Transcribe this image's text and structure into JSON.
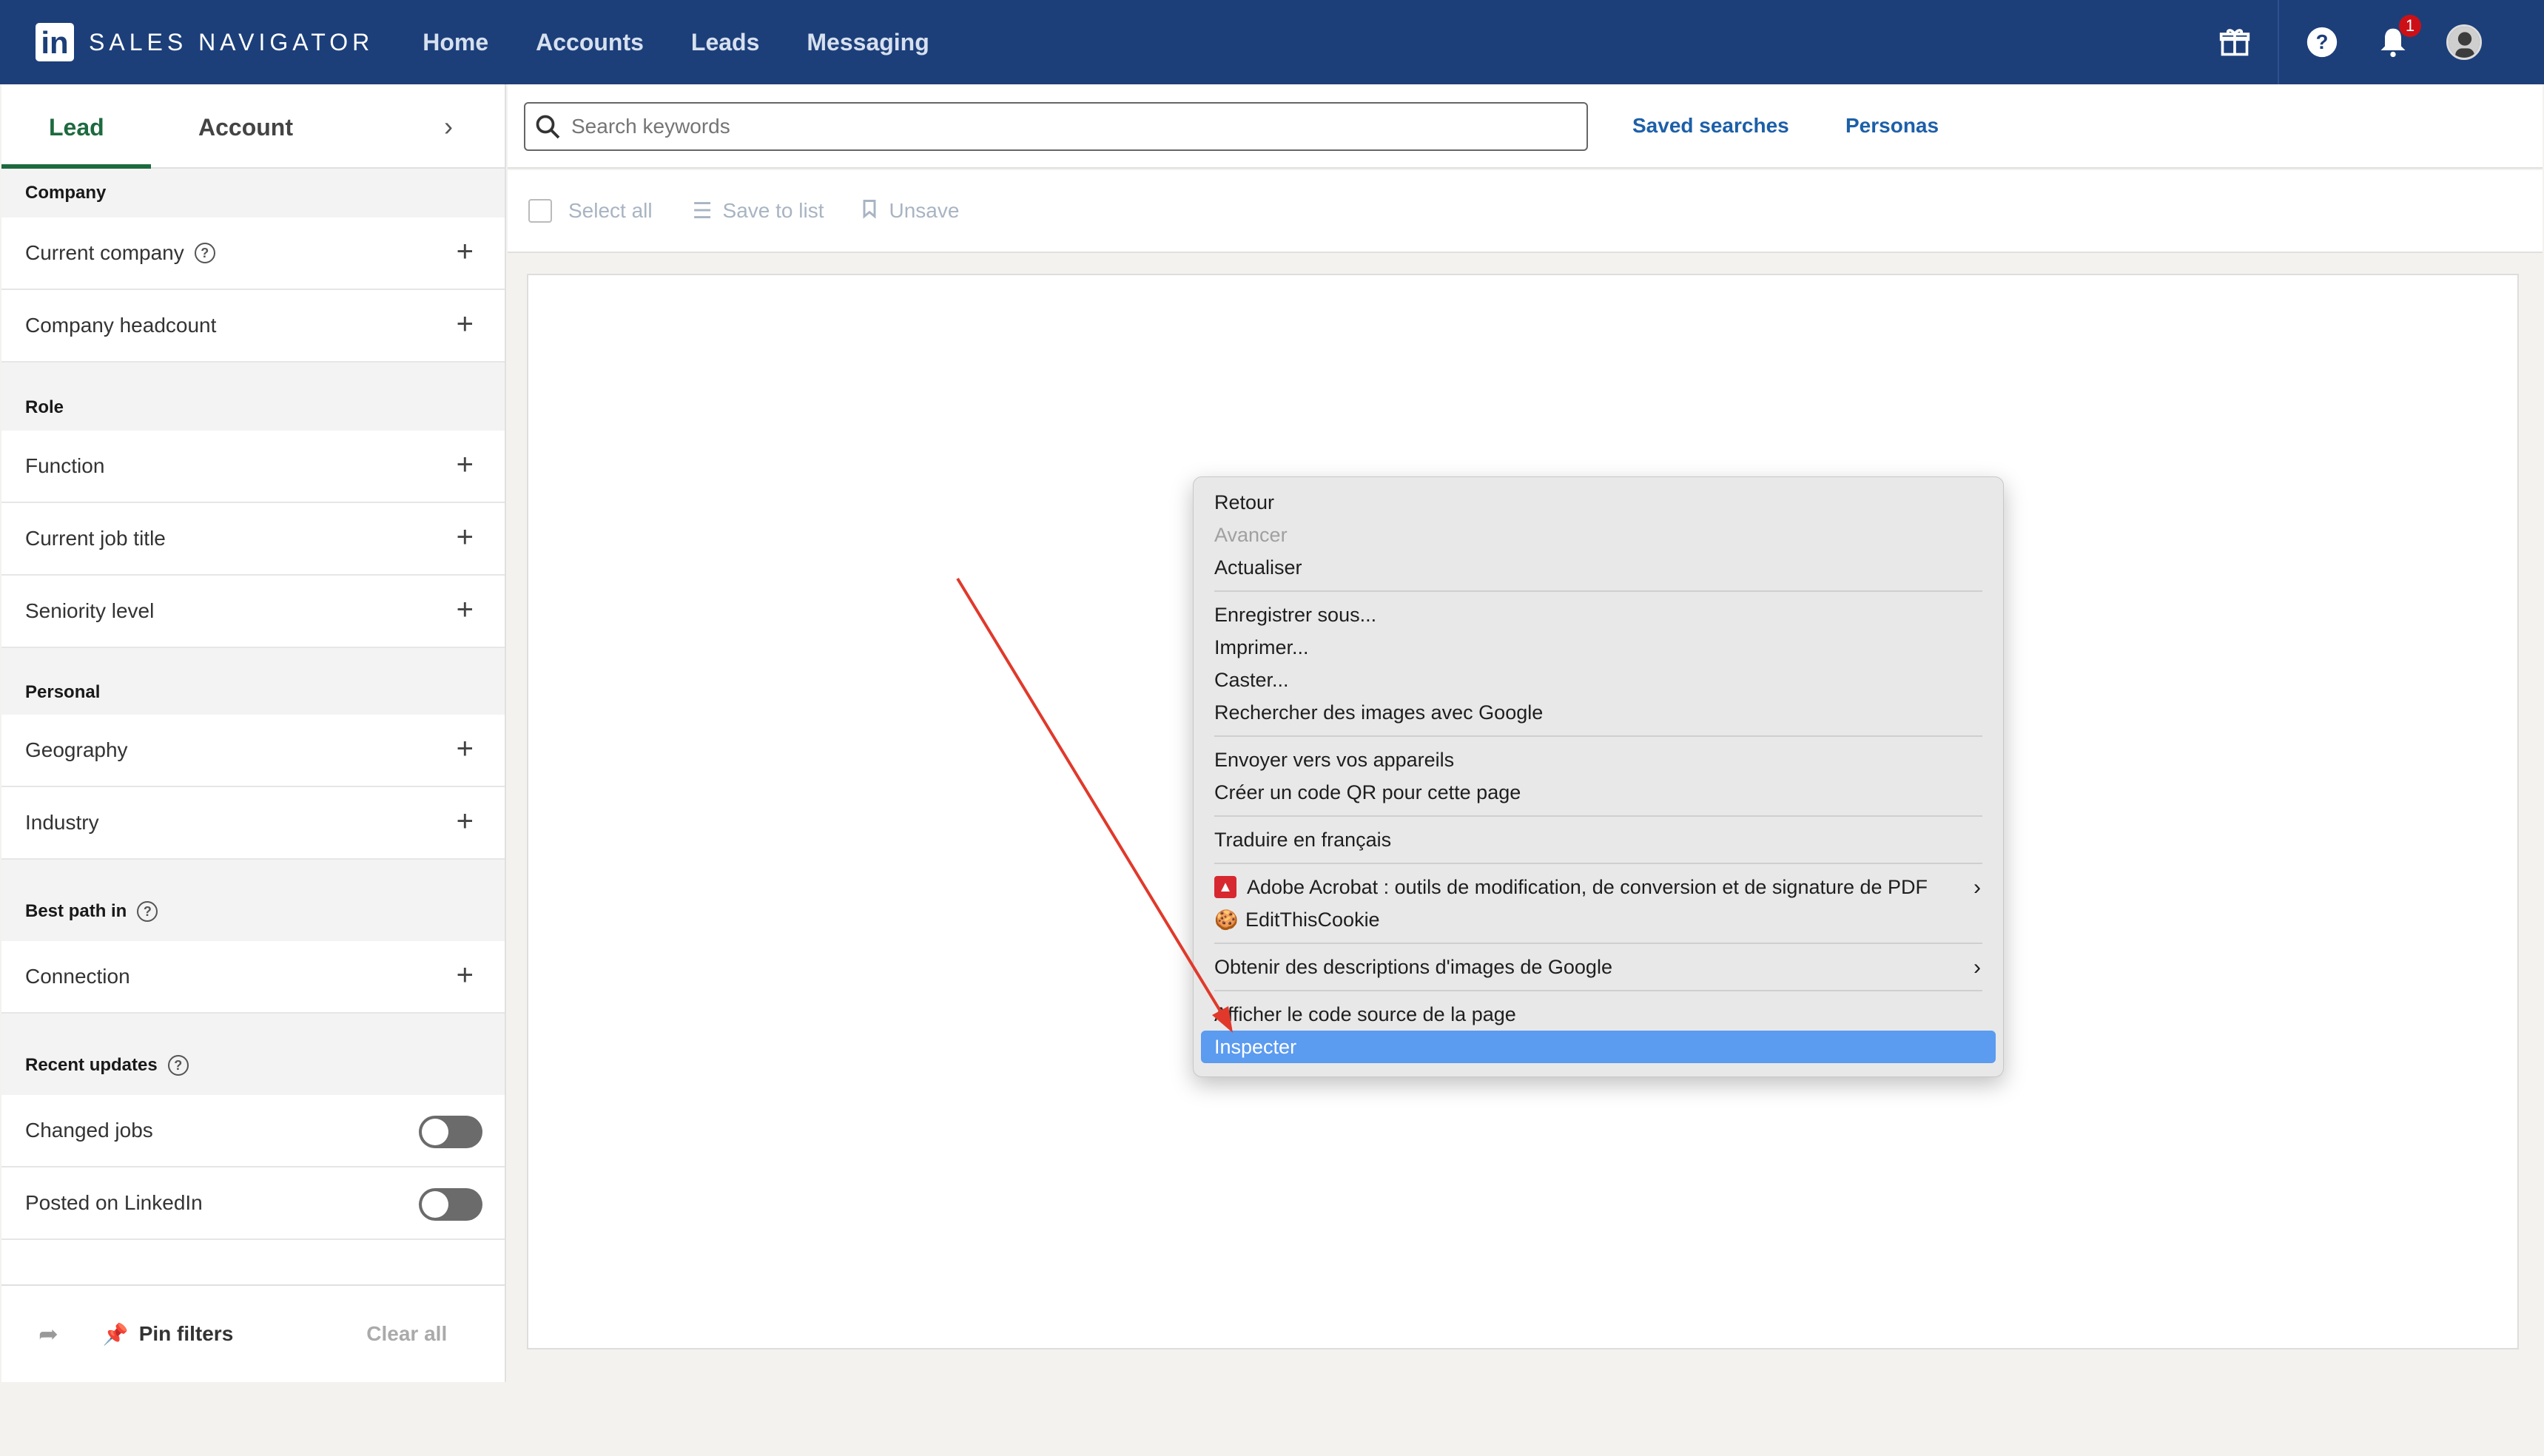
{
  "topbar": {
    "logo_text": "in",
    "brand": "SALES NAVIGATOR",
    "nav": [
      "Home",
      "Accounts",
      "Leads",
      "Messaging"
    ],
    "notification_count": "1"
  },
  "sidebar": {
    "tabs": {
      "lead": "Lead",
      "account": "Account"
    },
    "sections": {
      "company": "Company",
      "role": "Role",
      "personal": "Personal",
      "best_path": "Best path in",
      "recent_updates": "Recent updates"
    },
    "filters": {
      "current_company": "Current company",
      "company_headcount": "Company headcount",
      "function": "Function",
      "current_job_title": "Current job title",
      "seniority_level": "Seniority level",
      "geography": "Geography",
      "industry": "Industry",
      "connection": "Connection",
      "changed_jobs": "Changed jobs",
      "posted_on_linkedin": "Posted on LinkedIn"
    },
    "footer": {
      "pin": "Pin filters",
      "clear": "Clear all"
    }
  },
  "search": {
    "placeholder": "Search keywords",
    "saved_searches": "Saved searches",
    "personas": "Personas"
  },
  "toolbar": {
    "select_all": "Select all",
    "save_to_list": "Save to list",
    "unsave": "Unsave"
  },
  "context_menu": {
    "retour": "Retour",
    "avancer": "Avancer",
    "actualiser": "Actualiser",
    "enregistrer": "Enregistrer sous...",
    "imprimer": "Imprimer...",
    "caster": "Caster...",
    "rechercher_images": "Rechercher des images avec Google",
    "envoyer": "Envoyer vers vos appareils",
    "qr": "Créer un code QR pour cette page",
    "traduire": "Traduire en français",
    "acrobat": "Adobe Acrobat : outils de modification, de conversion et de signature de PDF",
    "editcookie": "EditThisCookie",
    "descriptions": "Obtenir des descriptions d'images de Google",
    "source": "Afficher le code source de la page",
    "inspecter": "Inspecter"
  },
  "colors": {
    "topbar": "#1c3f7a",
    "accent_green": "#1d6a3f",
    "link_blue": "#1c5fa8",
    "menu_highlight": "#5b9bf0",
    "annotation_arrow": "#e0392b"
  }
}
